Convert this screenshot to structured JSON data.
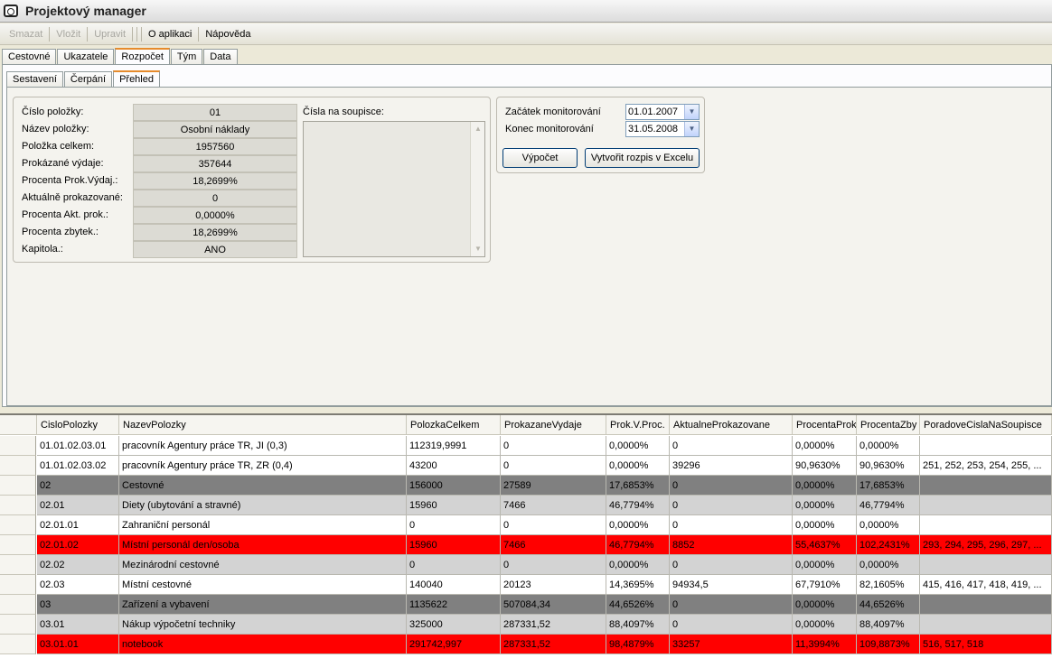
{
  "window": {
    "title": "Projektový manager"
  },
  "toolbar": {
    "smazat": "Smazat",
    "vlozit": "Vložit",
    "upravit": "Upravit",
    "o_aplikaci": "O aplikaci",
    "napoveda": "Nápověda"
  },
  "main_tabs": [
    "Cestovné",
    "Ukazatele",
    "Rozpočet",
    "Tým",
    "Data"
  ],
  "sub_tabs": [
    "Sestavení",
    "Čerpání",
    "Přehled"
  ],
  "detail": {
    "fields": [
      {
        "label": "Číslo položky:",
        "value": "01"
      },
      {
        "label": "Název položky:",
        "value": "Osobní náklady"
      },
      {
        "label": "Položka celkem:",
        "value": "1957560"
      },
      {
        "label": "Prokázané výdaje:",
        "value": "357644"
      },
      {
        "label": "Procenta Prok.Výdaj.:",
        "value": "18,2699%"
      },
      {
        "label": "Aktuálně prokazované:",
        "value": "0"
      },
      {
        "label": "Procenta Akt. prok.:",
        "value": "0,0000%"
      },
      {
        "label": "Procenta zbytek.:",
        "value": "18,2699%"
      },
      {
        "label": "Kapitola.:",
        "value": "ANO"
      }
    ],
    "soupis_label": "Čísla na soupisce:"
  },
  "monitoring": {
    "start_label": "Začátek monitorování",
    "start_value": "01.01.2007",
    "end_label": "Konec monitorování",
    "end_value": "31.05.2008",
    "calc_button": "Výpočet",
    "excel_button": "Vytvořit rozpis v Excelu"
  },
  "grid": {
    "columns": [
      "CisloPolozky",
      "NazevPolozky",
      "PolozkaCelkem",
      "ProkazaneVydaje",
      "Prok.V.Proc.",
      "AktualneProkazovane",
      "ProcentaProk",
      "ProcentaZby",
      "PoradoveCislaNaSoupisce"
    ],
    "rows": [
      {
        "style": "white",
        "cells": [
          "01.01.02.03.01",
          "pracovník Agentury práce TR, JI (0,3)",
          "112319,9991",
          "0",
          "0,0000%",
          "0",
          "0,0000%",
          "0,0000%",
          ""
        ]
      },
      {
        "style": "white",
        "cells": [
          "01.01.02.03.02",
          "pracovník Agentury práce TR, ZR (0,4)",
          "43200",
          "0",
          "0,0000%",
          "39296",
          "90,9630%",
          "90,9630%",
          "251, 252, 253, 254, 255, ..."
        ]
      },
      {
        "style": "dark",
        "cells": [
          "02",
          "Cestovné",
          "156000",
          "27589",
          "17,6853%",
          "0",
          "0,0000%",
          "17,6853%",
          ""
        ]
      },
      {
        "style": "light",
        "cells": [
          "02.01",
          "Diety (ubytování a stravné)",
          "15960",
          "7466",
          "46,7794%",
          "0",
          "0,0000%",
          "46,7794%",
          ""
        ]
      },
      {
        "style": "white",
        "cells": [
          "02.01.01",
          "Zahraniční personál",
          "0",
          "0",
          "0,0000%",
          "0",
          "0,0000%",
          "0,0000%",
          ""
        ]
      },
      {
        "style": "red",
        "cells": [
          "02.01.02",
          "Místní personál den/osoba",
          "15960",
          "7466",
          "46,7794%",
          "8852",
          "55,4637%",
          "102,2431%",
          "293, 294, 295, 296, 297, ..."
        ]
      },
      {
        "style": "light",
        "cells": [
          "02.02",
          "Mezinárodní cestovné",
          "0",
          "0",
          "0,0000%",
          "0",
          "0,0000%",
          "0,0000%",
          ""
        ]
      },
      {
        "style": "white",
        "cells": [
          "02.03",
          "Místní cestovné",
          "140040",
          "20123",
          "14,3695%",
          "94934,5",
          "67,7910%",
          "82,1605%",
          "415, 416, 417, 418, 419, ..."
        ]
      },
      {
        "style": "dark",
        "cells": [
          "03",
          "Zařízení a vybavení",
          "1135622",
          "507084,34",
          "44,6526%",
          "0",
          "0,0000%",
          "44,6526%",
          ""
        ]
      },
      {
        "style": "light",
        "cells": [
          "03.01",
          "Nákup výpočetní techniky",
          "325000",
          "287331,52",
          "88,4097%",
          "0",
          "0,0000%",
          "88,4097%",
          ""
        ]
      },
      {
        "style": "red",
        "cells": [
          "03.01.01",
          "notebook",
          "291742,997",
          "287331,52",
          "98,4879%",
          "33257",
          "11,3994%",
          "109,8873%",
          "516, 517, 518"
        ]
      }
    ]
  }
}
